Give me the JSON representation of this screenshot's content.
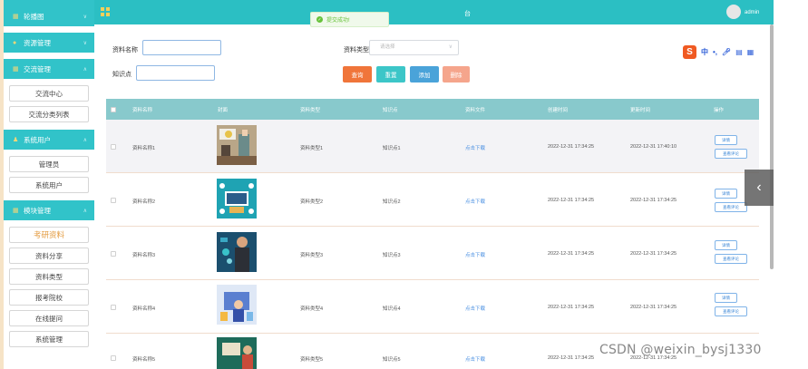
{
  "sidebar": {
    "top_partial": "轮播图",
    "groups": [
      {
        "label": "轮播图",
        "icon": "grid-icon"
      },
      {
        "label": "资源管理",
        "icon": "dot-icon"
      },
      {
        "label": "交流管理",
        "icon": "grid-icon"
      }
    ],
    "exchange_items": [
      "交流中心",
      "交流分类列表"
    ],
    "user_group": {
      "label": "系统用户",
      "icon": "user-icon"
    },
    "user_items": [
      "管理员",
      "系统用户"
    ],
    "module_group": {
      "label": "模块管理",
      "icon": "grid-icon"
    },
    "module_items": [
      "考研资料",
      "资料分享",
      "资料类型",
      "报考院校",
      "在线提问",
      "系统管理"
    ]
  },
  "topbar": {
    "title": "台",
    "admin": "admin"
  },
  "toast": {
    "message": "提交成功!"
  },
  "search": {
    "name_label": "资料名称",
    "name_value": "",
    "type_label": "资料类型",
    "type_placeholder": "请选择",
    "kp_label": "知识点",
    "kp_value": ""
  },
  "buttons": {
    "query": "查询",
    "reset": "重置",
    "add": "添加",
    "delete": "删除"
  },
  "colors": {
    "primary_teal": "#2bbfc3",
    "query": "#f0753a",
    "reset": "#3cc6c8",
    "add": "#4aa3d9",
    "delete": "#f5a58c"
  },
  "ime": {
    "label": "中",
    "punct": "•,"
  },
  "table": {
    "headers": [
      "资料名称",
      "封面",
      "资料类型",
      "知识点",
      "资料文件",
      "创建时间",
      "更新时间",
      "操作"
    ],
    "rows": [
      {
        "name": "资料名称1",
        "type": "资料类型1",
        "kp": "知识点1",
        "file": "点击下载",
        "created": "2022-12-31 17:34:25",
        "updated": "2022-12-31 17:40:10",
        "cover": "cover-photo-1"
      },
      {
        "name": "资料名称2",
        "type": "资料类型2",
        "kp": "知识点2",
        "file": "点击下载",
        "created": "2022-12-31 17:34:25",
        "updated": "2022-12-31 17:34:25",
        "cover": "cover-photo-2"
      },
      {
        "name": "资料名称3",
        "type": "资料类型3",
        "kp": "知识点3",
        "file": "点击下载",
        "created": "2022-12-31 17:34:25",
        "updated": "2022-12-31 17:34:25",
        "cover": "cover-photo-3"
      },
      {
        "name": "资料名称4",
        "type": "资料类型4",
        "kp": "知识点4",
        "file": "点击下载",
        "created": "2022-12-31 17:34:25",
        "updated": "2022-12-31 17:34:25",
        "cover": "cover-photo-4"
      },
      {
        "name": "资料名称5",
        "type": "资料类型5",
        "kp": "知识点5",
        "file": "点击下载",
        "created": "2022-12-31 17:34:25",
        "updated": "2022-12-31 17:34:25",
        "cover": "cover-photo-5"
      }
    ],
    "op_detail": "详情",
    "op_comment": "查看评论"
  },
  "watermark": "CSDN @weixin_bysj1330"
}
